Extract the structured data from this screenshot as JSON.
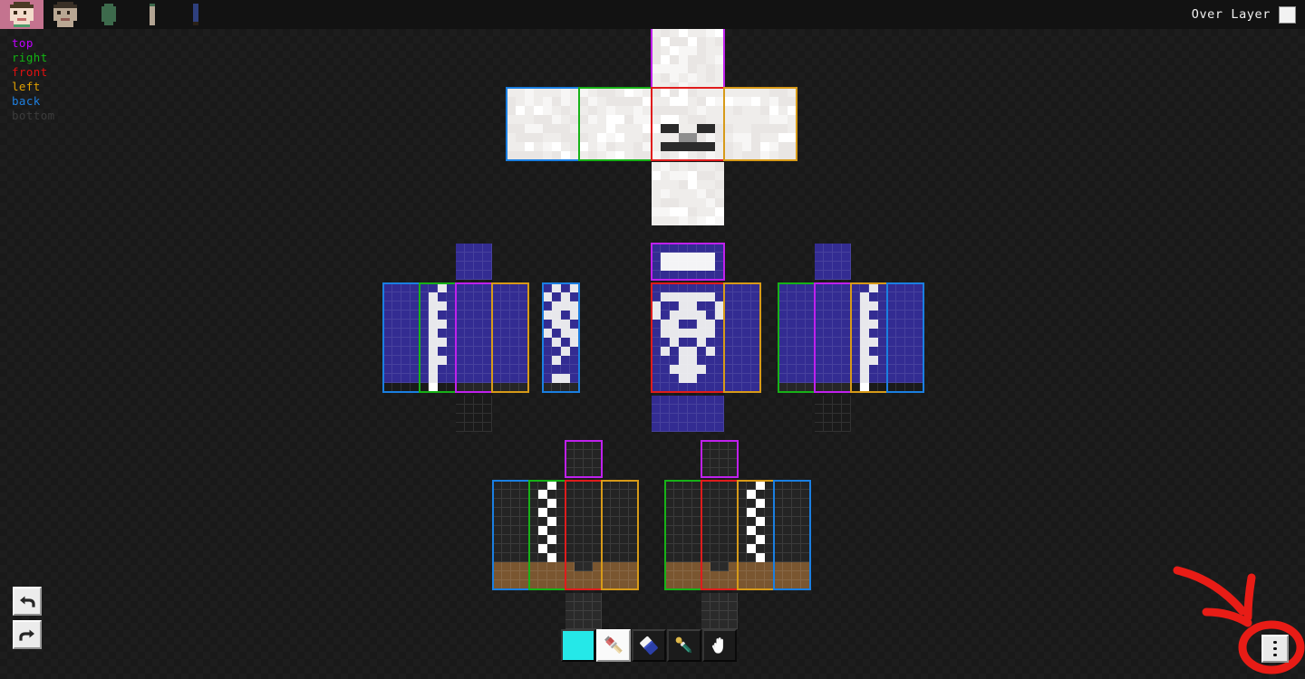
{
  "app": {
    "title": "Minecraft Skin Editor",
    "background_color": "#1d1d1d",
    "tabbar_color": "#121212"
  },
  "tabbar": {
    "active_tab_color": "#c4738f",
    "tabs": [
      {
        "id": "tab-head",
        "label": "Head",
        "icon": "head-icon",
        "active": true
      },
      {
        "id": "tab-head-alt",
        "label": "Head Alt",
        "icon": "head-alt-icon",
        "active": false
      },
      {
        "id": "tab-body",
        "label": "Body",
        "icon": "torso-icon",
        "active": false
      },
      {
        "id": "tab-arm",
        "label": "Arm",
        "icon": "arm-icon",
        "active": false
      },
      {
        "id": "tab-leg",
        "label": "Leg",
        "icon": "leg-icon",
        "active": false
      }
    ],
    "over_layer": {
      "label": "Over Layer",
      "checked": true,
      "checkbox_color": "#f2f2f2"
    }
  },
  "legend": {
    "items": [
      {
        "label": "top",
        "color": "#bf00ff"
      },
      {
        "label": "right",
        "color": "#12b412"
      },
      {
        "label": "front",
        "color": "#e01010"
      },
      {
        "label": "left",
        "color": "#e0a000"
      },
      {
        "label": "back",
        "color": "#1e7fe0"
      },
      {
        "label": "bottom",
        "color": "#3c3c3c"
      }
    ]
  },
  "face_outline_colors": {
    "top": "#c020ee",
    "right": "#17b217",
    "front": "#e01c1c",
    "left": "#d79a18",
    "back": "#1a7fe2",
    "bottom": "#3a3a3a"
  },
  "skin": {
    "head": {
      "name": "head-net",
      "base_color": "#f0eeec",
      "pixel_size": 10,
      "note": "skull-like white head, dark eyes and mouth on the front face"
    },
    "torso": {
      "name": "torso-net",
      "base_color": "#332c92",
      "bone_color": "#e8e8ec",
      "pixel_size": 10,
      "note": "blue hoodie with white skeleton ribcage on the front"
    },
    "legs": {
      "name": "legs-net",
      "base_color": "#242424",
      "shoe_color": "#7a5630",
      "stripe_color": "#ffffff",
      "pixel_size": 10,
      "note": "dark trousers with white checkered side stripes and brown shoes"
    }
  },
  "tools": {
    "selected": "brush",
    "items": [
      {
        "id": "color-swatch",
        "label": "Current Color",
        "icon": "color-swatch-icon",
        "color": "#25e8e8",
        "selected": false
      },
      {
        "id": "brush-tool",
        "label": "Brush",
        "icon": "paintbrush-icon",
        "selected": true
      },
      {
        "id": "eraser-tool",
        "label": "Eraser",
        "icon": "eraser-icon",
        "selected": false
      },
      {
        "id": "eyedropper-tool",
        "label": "Color Picker",
        "icon": "eyedropper-icon",
        "selected": false
      },
      {
        "id": "hand-tool",
        "label": "Pan",
        "icon": "hand-icon",
        "selected": false
      }
    ]
  },
  "history": {
    "undo": {
      "label": "Undo",
      "icon": "undo-arrow-icon"
    },
    "redo": {
      "label": "Redo",
      "icon": "redo-arrow-icon"
    }
  },
  "overflow_menu": {
    "label": "More options",
    "icon": "three-dots-vertical-icon",
    "annotation_color": "#e81c16",
    "annotation": "red hand-drawn arrow pointing at the menu button"
  }
}
